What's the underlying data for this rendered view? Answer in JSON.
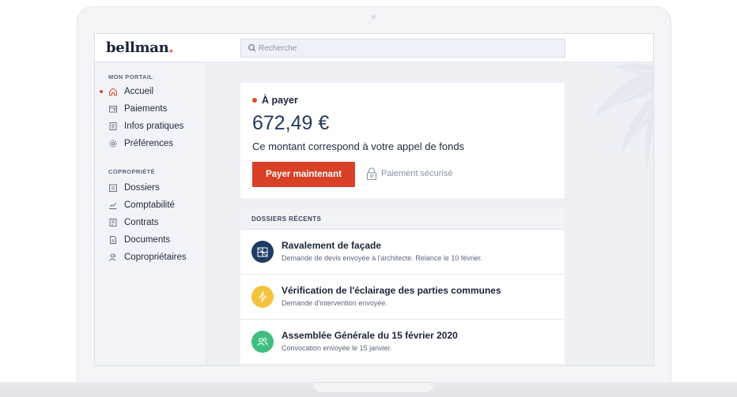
{
  "brand": {
    "name": "bellman",
    "dot": "."
  },
  "search": {
    "placeholder": "Recherche"
  },
  "sidebar": {
    "section1_title": "MON PORTAIL",
    "section1_items": [
      {
        "label": "Accueil",
        "icon": "home-icon",
        "active": true
      },
      {
        "label": "Paiements",
        "icon": "wallet-icon"
      },
      {
        "label": "Infos pratiques",
        "icon": "info-doc-icon"
      },
      {
        "label": "Préférences",
        "icon": "gear-icon"
      }
    ],
    "section2_title": "COPROPRIÉTÉ",
    "section2_items": [
      {
        "label": "Dossiers",
        "icon": "folder-icon"
      },
      {
        "label": "Comptabilité",
        "icon": "chart-line-icon"
      },
      {
        "label": "Contrats",
        "icon": "contract-icon"
      },
      {
        "label": "Documents",
        "icon": "document-icon"
      },
      {
        "label": "Copropriétaires",
        "icon": "users-icon"
      }
    ]
  },
  "payment": {
    "status": "À payer",
    "amount": "672,49 €",
    "description": "Ce montant correspond à votre appel de fonds",
    "button": "Payer maintenant",
    "secure_label": "Paiement sécurisé"
  },
  "recent_files": {
    "title": "DOSSIERS RÉCENTS",
    "items": [
      {
        "title": "Ravalement de façade",
        "subtitle": "Demande de devis envoyée à l'architecte. Relance le 10 février.",
        "icon": "scaffold-icon",
        "color": "#1f3b63"
      },
      {
        "title": "Vérification de l'éclairage des parties communes",
        "subtitle": "Demande d'intervention envoyée.",
        "icon": "lightning-icon",
        "color": "#f4c23c"
      },
      {
        "title": "Assemblée Générale du 15 février 2020",
        "subtitle": "Convocation envoyée le 15 janvier.",
        "icon": "people-icon",
        "color": "#3fbf7f"
      }
    ]
  },
  "colors": {
    "accent": "#d84125",
    "navy": "#24395e",
    "sidebar_bg": "#f1f3f8"
  }
}
